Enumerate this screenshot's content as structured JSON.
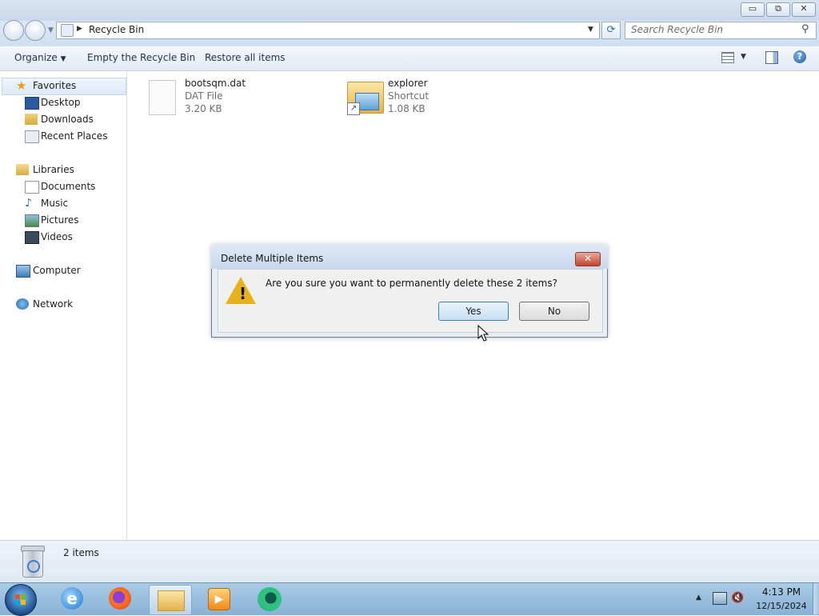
{
  "window": {
    "title_buttons": {
      "minimize": "▭",
      "maximize": "⧉",
      "close": "✕"
    }
  },
  "address": {
    "path": "Recycle Bin",
    "search_placeholder": "Search Recycle Bin"
  },
  "commandbar": {
    "organize": "Organize",
    "empty_recycle_bin": "Empty the Recycle Bin",
    "restore_all": "Restore all items"
  },
  "navigation": {
    "favorites": {
      "label": "Favorites",
      "items": [
        "Desktop",
        "Downloads",
        "Recent Places"
      ]
    },
    "libraries": {
      "label": "Libraries",
      "items": [
        "Documents",
        "Music",
        "Pictures",
        "Videos"
      ]
    },
    "computer": "Computer",
    "network": "Network"
  },
  "files": [
    {
      "name": "bootsqm.dat",
      "type": "DAT File",
      "size": "3.20 KB",
      "icon": "generic-file-icon"
    },
    {
      "name": "explorer",
      "type": "Shortcut",
      "size": "1.08 KB",
      "icon": "folder-shortcut-icon"
    }
  ],
  "status": {
    "count": "2 items"
  },
  "dialog": {
    "title": "Delete Multiple Items",
    "message": "Are you sure you want to permanently delete these 2 items?",
    "yes": "Yes",
    "no": "No",
    "close": "✕"
  },
  "taskbar": {
    "apps": [
      "start-orb",
      "internet-explorer",
      "firefox",
      "windows-explorer",
      "media-player",
      "edge-beta"
    ],
    "time": "4:13 PM",
    "date": "12/15/2024"
  },
  "colors": {
    "titlebar": "#c9d8ea",
    "taskbar": "#87b2d5",
    "dialog_default_button": "#3c7fb1",
    "close_button": "#c4432c"
  }
}
